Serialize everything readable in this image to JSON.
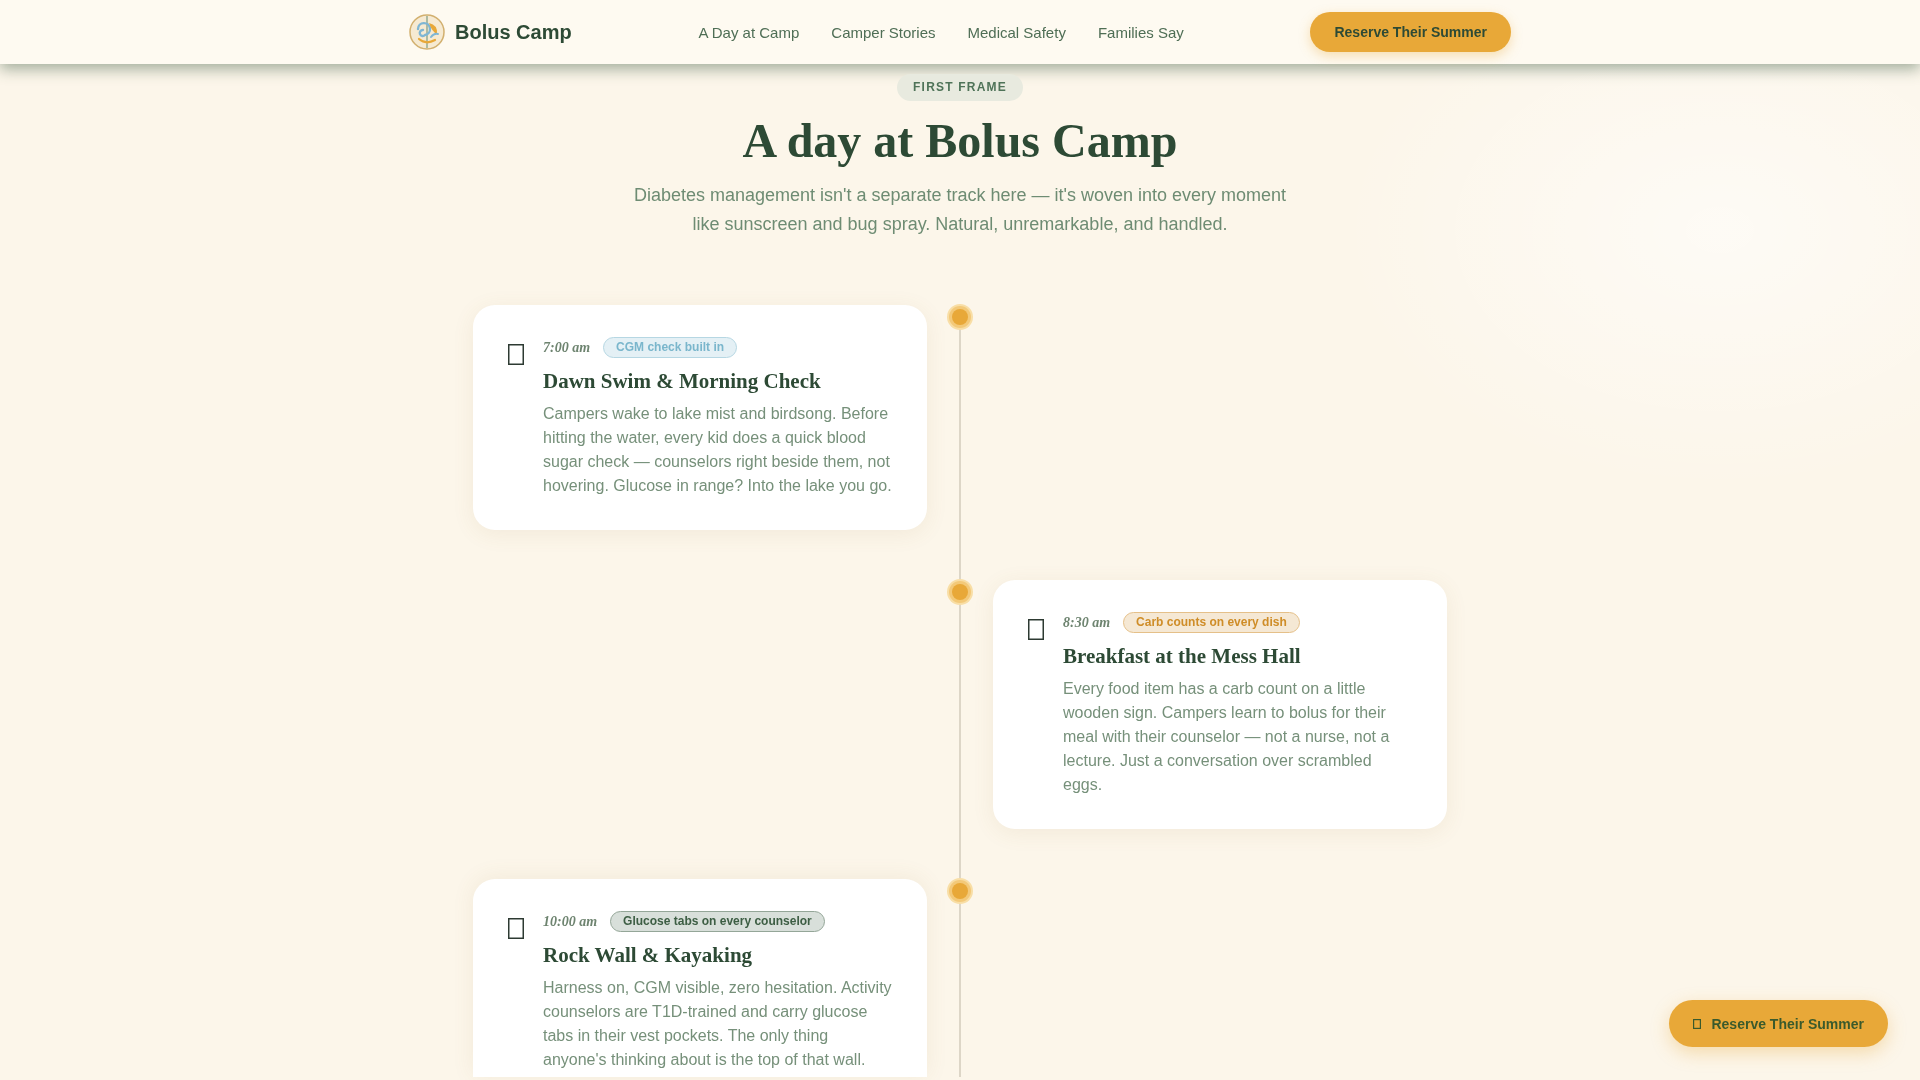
{
  "header": {
    "brand": "Bolus Camp",
    "nav": [
      "A Day at Camp",
      "Camper Stories",
      "Medical Safety",
      "Families Say"
    ],
    "cta": "Reserve Their Summer"
  },
  "hero": {
    "eyebrow": "FIRST FRAME",
    "title": "A day at Bolus Camp",
    "subtitle": "Diabetes management isn't a separate track here — it's woven into every moment like sunscreen and bug spray. Natural, unremarkable, and handled."
  },
  "timeline": [
    {
      "time": "7:00 am",
      "tag": {
        "label": "CGM check built in",
        "color": "#7ab6cc"
      },
      "title": "Dawn Swim & Morning Check",
      "text": "Campers wake to lake mist and birdsong. Before hitting the water, every kid does a quick blood sugar check — counselors right beside them, not hovering. Glucose in range? Into the lake you go."
    },
    {
      "time": "8:30 am",
      "tag": {
        "label": "Carb counts on every dish",
        "color": "#cf8d28"
      },
      "title": "Breakfast at the Mess Hall",
      "text": "Every food item has a carb count on a little wooden sign. Campers learn to bolus for their meal with their counselor — not a nurse, not a lecture. Just a conversation over scrambled eggs."
    },
    {
      "time": "10:00 am",
      "tag": {
        "label": "Glucose tabs on every counselor",
        "color": "#3d5e44"
      },
      "title": "Rock Wall & Kayaking",
      "text": "Harness on, CGM visible, zero hesitation. Activity counselors are T1D-trained and carry glucose tabs in their vest pockets. The only thing anyone's thinking about is the top of that wall."
    }
  ],
  "floating_button": {
    "label": "Reserve Their Summer"
  }
}
